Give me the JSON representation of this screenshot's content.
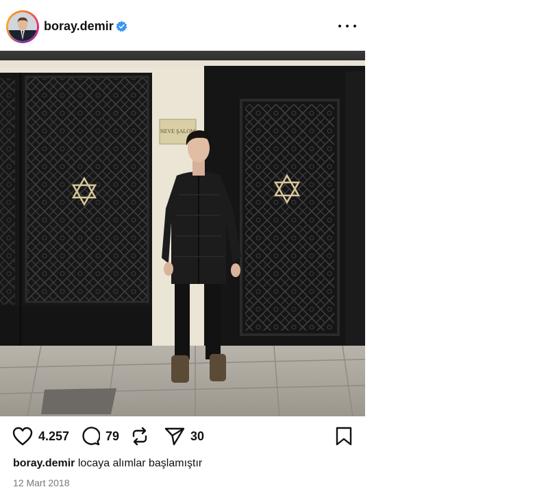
{
  "post": {
    "username": "boray.demir",
    "caption_user": "boray.demir",
    "caption_text": "locaya alımlar başlamıştır",
    "date": "12 Mart 2018"
  },
  "photo": {
    "plaque_text": "NEVE ŞALOM"
  },
  "actions": {
    "likes": "4.257",
    "comments": "79",
    "shares": "30"
  },
  "icons": {
    "verified": "verified-badge-icon",
    "more": "more-options-icon",
    "like": "heart-icon",
    "comment": "comment-icon",
    "repost": "repost-icon",
    "share": "send-icon",
    "save": "bookmark-icon"
  },
  "colors": {
    "verified_blue": "#3897f0",
    "text": "#111111",
    "muted": "#777777",
    "door": "#161616",
    "star": "#d8c79a"
  }
}
